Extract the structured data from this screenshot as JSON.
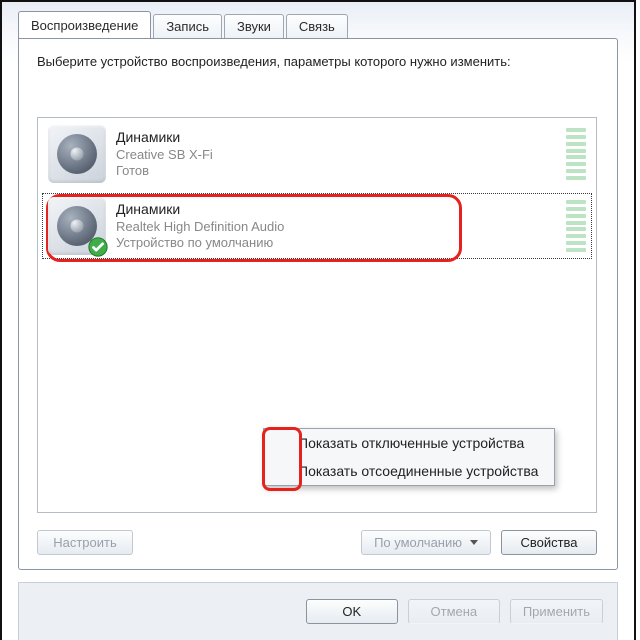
{
  "tabs": {
    "playback": "Воспроизведение",
    "recording": "Запись",
    "sounds": "Звуки",
    "comm": "Связь"
  },
  "instruction": "Выберите устройство воспроизведения, параметры которого нужно изменить:",
  "devices": [
    {
      "name": "Динамики",
      "sub": "Creative SB X-Fi",
      "status": "Готов"
    },
    {
      "name": "Динамики",
      "sub": "Realtek High Definition Audio",
      "status": "Устройство по умолчанию"
    }
  ],
  "context_menu": {
    "show_disabled": "Показать отключенные устройства",
    "show_disconnected": "Показать отсоединенные устройства"
  },
  "buttons": {
    "configure": "Настроить",
    "set_default": "По умолчанию",
    "properties": "Свойства",
    "ok": "OK",
    "cancel": "Отмена",
    "apply": "Применить"
  }
}
